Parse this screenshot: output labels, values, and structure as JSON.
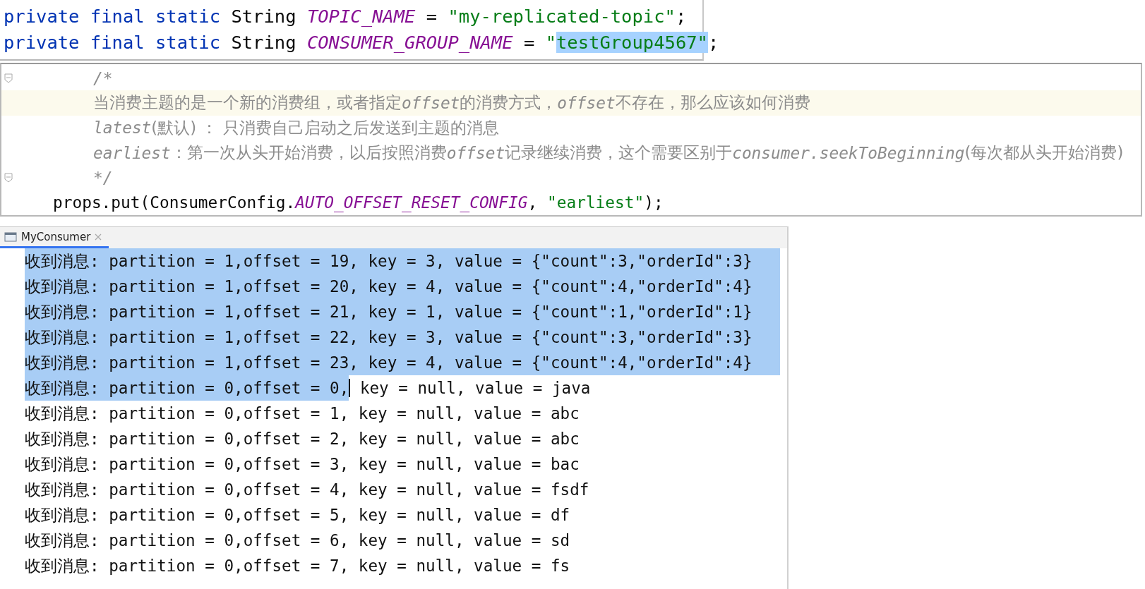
{
  "top_code": {
    "lines": [
      {
        "tokens": [
          {
            "kind": "keyword",
            "text": "private final static "
          },
          {
            "kind": "plain",
            "text": "String "
          },
          {
            "kind": "constant",
            "text": "TOPIC_NAME"
          },
          {
            "kind": "plain",
            "text": " = "
          },
          {
            "kind": "string",
            "text": "\"my-replicated-topic\""
          },
          {
            "kind": "plain",
            "text": ";"
          }
        ]
      },
      {
        "tokens": [
          {
            "kind": "keyword",
            "text": "private final static "
          },
          {
            "kind": "plain",
            "text": "String "
          },
          {
            "kind": "constant",
            "text": "CONSUMER_GROUP_NAME"
          },
          {
            "kind": "plain",
            "text": " = "
          },
          {
            "kind": "string",
            "text": "\""
          },
          {
            "kind": "string",
            "text": "testGroup4567\"",
            "selected": true
          },
          {
            "kind": "plain",
            "text": ";"
          }
        ]
      }
    ]
  },
  "comment_code": {
    "lines": [
      {
        "current": false,
        "fold": true,
        "kind": "comment",
        "tokens": [
          {
            "kind": "comment-code",
            "text": "/*"
          }
        ]
      },
      {
        "current": true,
        "fold": false,
        "kind": "comment",
        "tokens": [
          {
            "kind": "comment",
            "text": "当消费主题的是一个新的消费组，或者指定"
          },
          {
            "kind": "comment-code",
            "text": "offset"
          },
          {
            "kind": "comment",
            "text": "的消费方式，"
          },
          {
            "kind": "comment-code",
            "text": "offset"
          },
          {
            "kind": "comment",
            "text": "不存在，那么应该如何消费"
          }
        ]
      },
      {
        "current": false,
        "fold": false,
        "kind": "comment",
        "tokens": [
          {
            "kind": "comment-code",
            "text": "latest"
          },
          {
            "kind": "comment",
            "text": "(默认) ： 只消费自己启动之后发送到主题的消息"
          }
        ]
      },
      {
        "current": false,
        "fold": false,
        "kind": "comment",
        "tokens": [
          {
            "kind": "comment-code",
            "text": "earliest"
          },
          {
            "kind": "comment",
            "text": "：第一次从头开始消费，以后按照消费"
          },
          {
            "kind": "comment-code",
            "text": "offset"
          },
          {
            "kind": "comment",
            "text": "记录继续消费，这个需要区别于"
          },
          {
            "kind": "comment-code",
            "text": "consumer.seekToBeginning"
          },
          {
            "kind": "comment",
            "text": "(每次都从头开始消费)"
          }
        ]
      },
      {
        "current": false,
        "fold": true,
        "kind": "comment",
        "tokens": [
          {
            "kind": "comment-code",
            "text": "*/"
          }
        ]
      },
      {
        "current": false,
        "fold": false,
        "kind": "statement",
        "tokens": [
          {
            "kind": "plain",
            "text": "props.put(ConsumerConfig."
          },
          {
            "kind": "constant",
            "text": "AUTO_OFFSET_RESET_CONFIG"
          },
          {
            "kind": "plain",
            "text": ", "
          },
          {
            "kind": "string",
            "text": "\"earliest\""
          },
          {
            "kind": "plain",
            "text": ");"
          }
        ]
      }
    ]
  },
  "console": {
    "tab": {
      "label": "MyConsumer",
      "selected": true
    },
    "lines": [
      {
        "text": "收到消息: partition = 1,offset = 19, key = 3, value = {\"count\":3,\"orderId\":3}",
        "selected": true
      },
      {
        "text": "收到消息: partition = 1,offset = 20, key = 4, value = {\"count\":4,\"orderId\":4}",
        "selected": true
      },
      {
        "text": "收到消息: partition = 1,offset = 21, key = 1, value = {\"count\":1,\"orderId\":1}",
        "selected": true
      },
      {
        "text": "收到消息: partition = 1,offset = 22, key = 3, value = {\"count\":3,\"orderId\":3}",
        "selected": true
      },
      {
        "text": "收到消息: partition = 1,offset = 23, key = 4, value = {\"count\":4,\"orderId\":4}",
        "selected": true
      },
      {
        "text": "收到消息: partition = 0,offset = 0,",
        "selected": true,
        "rest": " key = null, value = java"
      },
      {
        "text": "收到消息: partition = 0,offset = 1, key = null, value = abc",
        "selected": false
      },
      {
        "text": "收到消息: partition = 0,offset = 2, key = null, value = abc",
        "selected": false
      },
      {
        "text": "收到消息: partition = 0,offset = 3, key = null, value = bac",
        "selected": false
      },
      {
        "text": "收到消息: partition = 0,offset = 4, key = null, value = fsdf",
        "selected": false
      },
      {
        "text": "收到消息: partition = 0,offset = 5, key = null, value = df",
        "selected": false
      },
      {
        "text": "收到消息: partition = 0,offset = 6, key = null, value = sd",
        "selected": false
      },
      {
        "text": "收到消息: partition = 0,offset = 7, key = null, value = fs",
        "selected": false
      }
    ]
  }
}
